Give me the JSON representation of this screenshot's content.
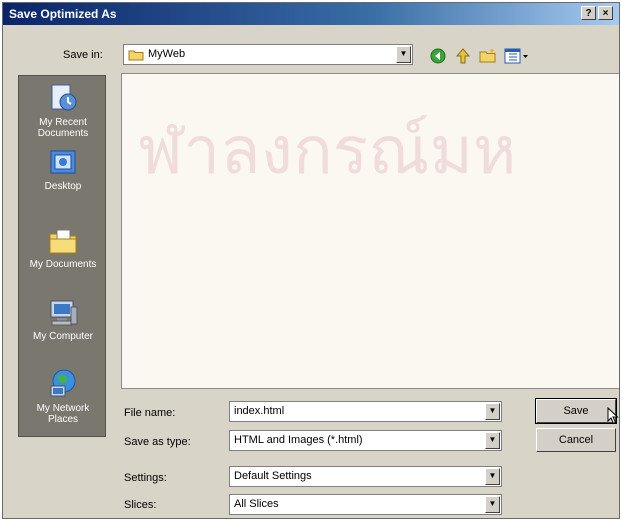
{
  "dialog": {
    "title": "Save Optimized As",
    "help_button": "?",
    "close_button": "×"
  },
  "save_in": {
    "label": "Save in:",
    "value": "MyWeb"
  },
  "places": [
    {
      "line1": "My Recent",
      "line2": "Documents",
      "icon": "recent-documents-icon"
    },
    {
      "line1": "Desktop",
      "line2": "",
      "icon": "desktop-icon"
    },
    {
      "line1": "My Documents",
      "line2": "",
      "icon": "my-documents-icon"
    },
    {
      "line1": "My Computer",
      "line2": "",
      "icon": "my-computer-icon"
    },
    {
      "line1": "My Network",
      "line2": "Places",
      "icon": "network-places-icon"
    }
  ],
  "watermark": "ฬาลงกรณ์มห",
  "fields": {
    "file_name": {
      "label": "File name:",
      "value": "index.html"
    },
    "save_as_type": {
      "label": "Save as type:",
      "value": "HTML and Images (*.html)"
    },
    "settings": {
      "label": "Settings:",
      "value": "Default Settings"
    },
    "slices": {
      "label": "Slices:",
      "value": "All Slices"
    }
  },
  "buttons": {
    "save": "Save",
    "cancel": "Cancel"
  },
  "colors": {
    "title_bar_start": "#0a246a",
    "title_bar_end": "#a6caf0",
    "dialog_face": "#d8d4c8",
    "places_bar": "#7a776e"
  }
}
